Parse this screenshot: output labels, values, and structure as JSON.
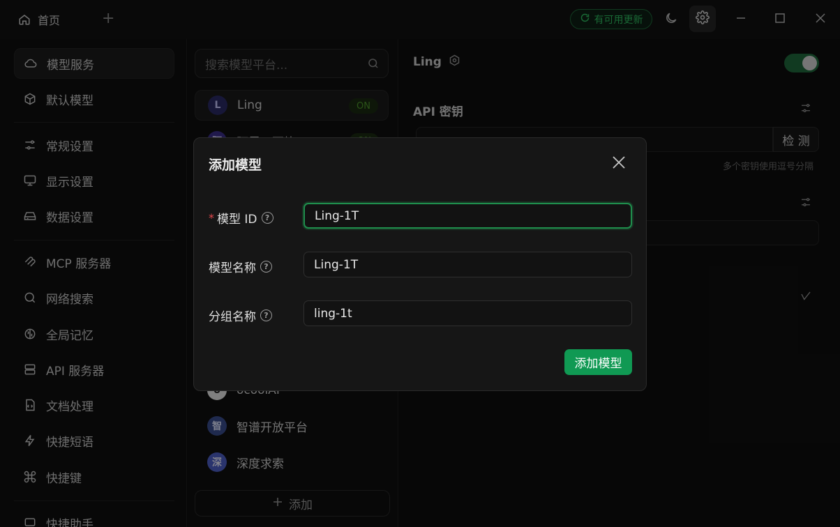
{
  "titlebar": {
    "home_tab": "首页",
    "add_tab": "+",
    "update_label": "有可用更新"
  },
  "sidebar": {
    "items": [
      {
        "label": "模型服务",
        "icon": "cloud-icon"
      },
      {
        "label": "默认模型",
        "icon": "cube-icon"
      },
      {
        "label": "常规设置",
        "icon": "sliders-icon"
      },
      {
        "label": "显示设置",
        "icon": "monitor-icon"
      },
      {
        "label": "数据设置",
        "icon": "hard-drive-icon"
      },
      {
        "label": "MCP 服务器",
        "icon": "mcp-icon"
      },
      {
        "label": "网络搜索",
        "icon": "search-icon"
      },
      {
        "label": "全局记忆",
        "icon": "brain-icon"
      },
      {
        "label": "API 服务器",
        "icon": "server-icon"
      },
      {
        "label": "文档处理",
        "icon": "file-code-icon"
      },
      {
        "label": "快捷短语",
        "icon": "zap-icon"
      },
      {
        "label": "快捷键",
        "icon": "command-icon"
      },
      {
        "label": "快捷助手",
        "icon": "assistant-icon"
      }
    ]
  },
  "providers": {
    "search_placeholder": "搜索模型平台...",
    "items": [
      {
        "name": "Ling",
        "avatar": "L",
        "status": "ON"
      },
      {
        "name": "阿里云百炼",
        "avatar": "阿",
        "status": "ON"
      },
      {
        "name": "ocoolAI",
        "avatar": "o"
      },
      {
        "name": "智谱开放平台",
        "avatar": "智"
      },
      {
        "name": "深度求索",
        "avatar": "深"
      }
    ],
    "add_label": "添加"
  },
  "detail": {
    "title": "Ling",
    "api_key_label": "API 密钥",
    "check_label": "检 测",
    "key_hint": "多个密钥使用逗号分隔"
  },
  "modal": {
    "title": "添加模型",
    "fields": [
      {
        "label": "模型 ID",
        "required": true,
        "value": "Ling-1T"
      },
      {
        "label": "模型名称",
        "required": false,
        "value": "Ling-1T"
      },
      {
        "label": "分组名称",
        "required": false,
        "value": "ling-1t"
      }
    ],
    "required_mark": "*",
    "help_mark": "?",
    "submit_label": "添加模型"
  },
  "colors": {
    "accent": "#109953",
    "danger": "#e5484d",
    "background": "#0d0d0d"
  }
}
